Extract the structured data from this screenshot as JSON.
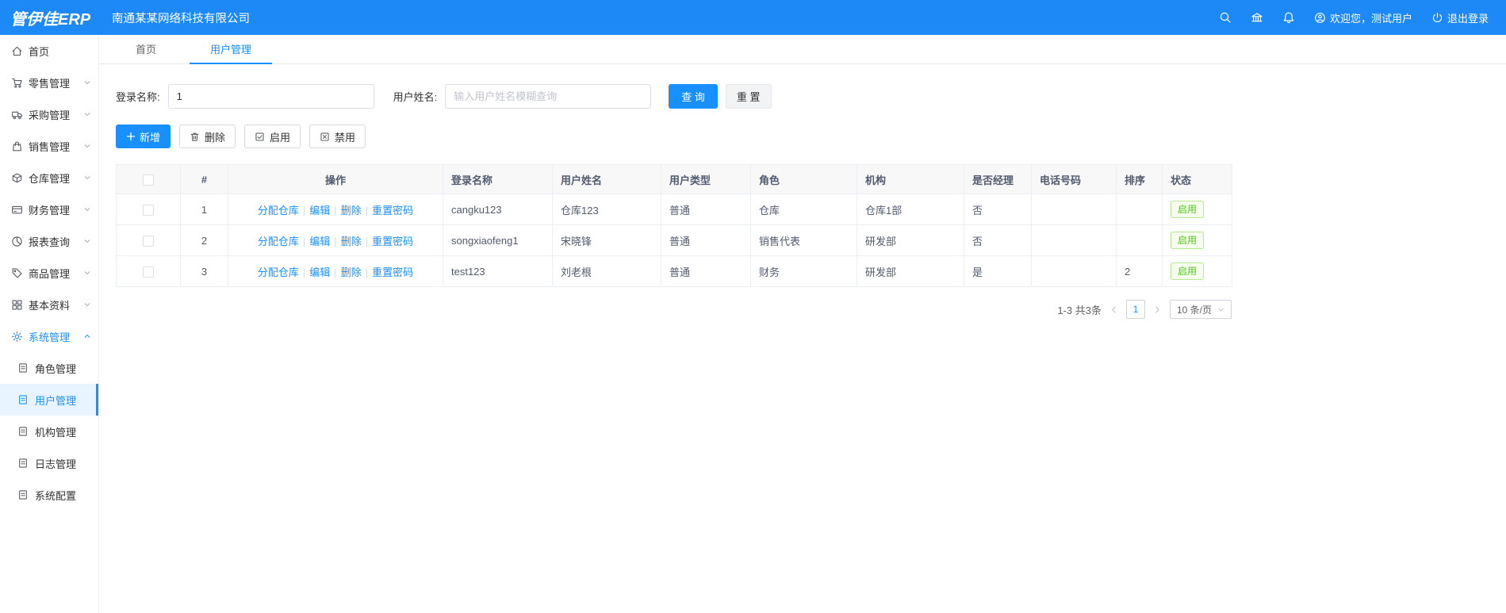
{
  "app": {
    "logo": "管伊佳ERP",
    "company": "南通某某网络科技有限公司"
  },
  "header": {
    "welcome": "欢迎您，测试用户",
    "logout": "退出登录",
    "icons": [
      "search-icon",
      "bank-icon",
      "bell-icon",
      "user-circle-icon",
      "power-icon"
    ]
  },
  "colors": {
    "primary": "#1890ff",
    "header_bg": "#1d89f6",
    "status_green": "#52c41a",
    "selected_bg": "#e8f4ff"
  },
  "sidebar": {
    "items": [
      {
        "label": "首页",
        "icon": "home-icon"
      },
      {
        "label": "零售管理",
        "icon": "retail-icon"
      },
      {
        "label": "采购管理",
        "icon": "purchase-icon"
      },
      {
        "label": "销售管理",
        "icon": "sales-icon"
      },
      {
        "label": "仓库管理",
        "icon": "warehouse-icon"
      },
      {
        "label": "财务管理",
        "icon": "finance-icon"
      },
      {
        "label": "报表查询",
        "icon": "report-icon"
      },
      {
        "label": "商品管理",
        "icon": "product-icon"
      },
      {
        "label": "基本资料",
        "icon": "basic-data-icon"
      },
      {
        "label": "系统管理",
        "icon": "system-icon"
      }
    ],
    "system_submenu": [
      {
        "label": "角色管理",
        "icon": "role-icon"
      },
      {
        "label": "用户管理",
        "icon": "user-icon"
      },
      {
        "label": "机构管理",
        "icon": "org-icon"
      },
      {
        "label": "日志管理",
        "icon": "log-icon"
      },
      {
        "label": "系统配置",
        "icon": "config-icon"
      }
    ]
  },
  "tabs": [
    {
      "label": "首页"
    },
    {
      "label": "用户管理"
    }
  ],
  "search": {
    "login_label": "登录名称:",
    "login_value": "1",
    "name_label": "用户姓名:",
    "name_placeholder": "输入用户姓名模糊查询",
    "query_button": "查 询",
    "reset_button": "重 置"
  },
  "toolbar": {
    "add": "新增",
    "delete": "删除",
    "enable": "启用",
    "disable": "禁用"
  },
  "table": {
    "headers": [
      "#",
      "操作",
      "登录名称",
      "用户姓名",
      "用户类型",
      "角色",
      "机构",
      "是否经理",
      "电话号码",
      "排序",
      "状态"
    ],
    "op_links": [
      "分配仓库",
      "编辑",
      "删除",
      "重置密码"
    ],
    "rows": [
      {
        "index": "1",
        "login": "cangku123",
        "name": "仓库123",
        "type": "普通",
        "role": "仓库",
        "org": "仓库1部",
        "manager": "否",
        "phone": "",
        "sort": "",
        "status": "启用"
      },
      {
        "index": "2",
        "login": "songxiaofeng1",
        "name": "宋晓锋",
        "type": "普通",
        "role": "销售代表",
        "org": "研发部",
        "manager": "否",
        "phone": "",
        "sort": "",
        "status": "启用"
      },
      {
        "index": "3",
        "login": "test123",
        "name": "刘老根",
        "type": "普通",
        "role": "财务",
        "org": "研发部",
        "manager": "是",
        "phone": "",
        "sort": "2",
        "status": "启用"
      }
    ]
  },
  "pagination": {
    "total": "1-3 共3条",
    "page": "1",
    "page_size": "10 条/页"
  }
}
